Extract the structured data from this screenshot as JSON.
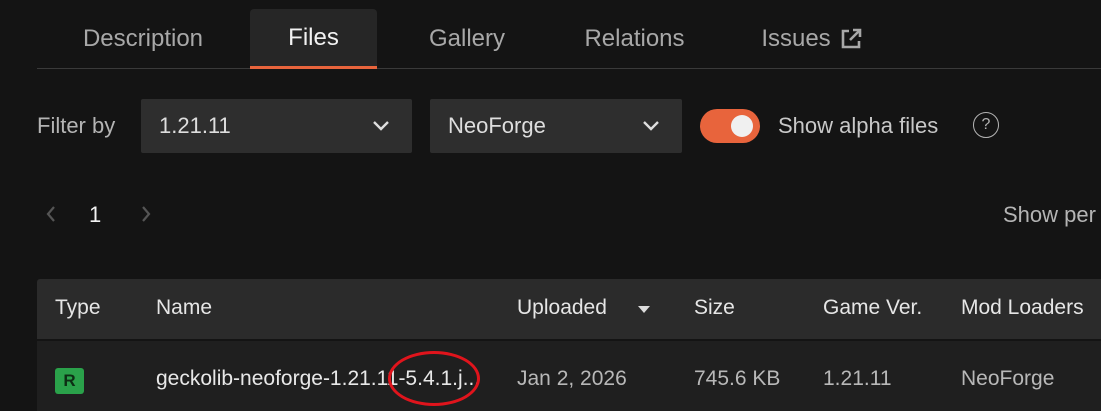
{
  "tabs": [
    {
      "label": "Description"
    },
    {
      "label": "Files"
    },
    {
      "label": "Gallery"
    },
    {
      "label": "Relations"
    },
    {
      "label": "Issues"
    }
  ],
  "filter": {
    "label": "Filter by",
    "version": "1.21.11",
    "loader": "NeoForge",
    "alpha_label": "Show alpha files",
    "alpha_enabled": true,
    "help": "?"
  },
  "pagination": {
    "current_page": "1",
    "show_per_page": "Show per"
  },
  "table": {
    "headers": {
      "type": "Type",
      "name": "Name",
      "uploaded": "Uploaded",
      "size": "Size",
      "game_version": "Game Ver.",
      "mod_loaders": "Mod Loaders"
    },
    "rows": [
      {
        "type": "R",
        "name": "geckolib-neoforge-1.21.11-5.4.1.j...",
        "uploaded": "Jan 2, 2026",
        "size": "745.6 KB",
        "game_version": "1.21.11",
        "mod_loaders": "NeoForge"
      }
    ]
  },
  "colors": {
    "accent": "#e8643c",
    "release_badge": "#2aa14a",
    "annotation": "#e0141c"
  }
}
